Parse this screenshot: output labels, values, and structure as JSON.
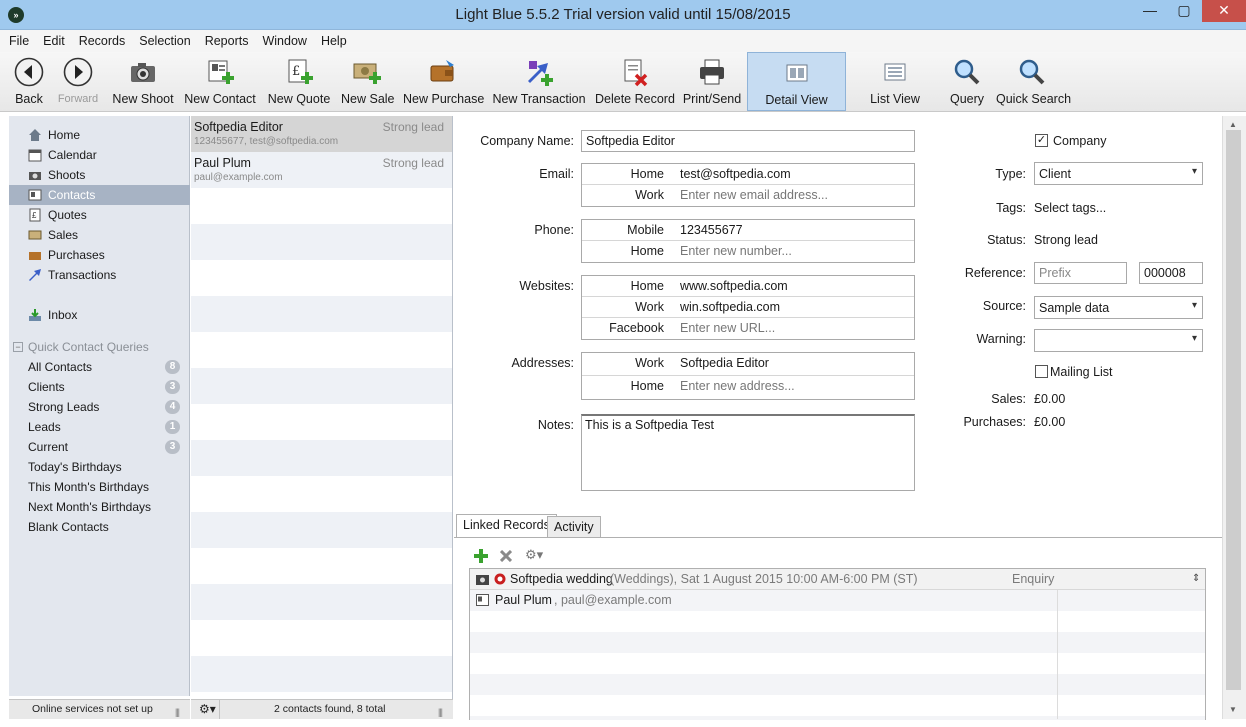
{
  "window": {
    "title": "Light Blue 5.5.2    Trial version valid until 15/08/2015",
    "controls": {
      "minimize": "—",
      "maximize": "▢",
      "close": "✕"
    }
  },
  "menu": [
    "File",
    "Edit",
    "Records",
    "Selection",
    "Reports",
    "Window",
    "Help"
  ],
  "toolbar": {
    "back": "Back",
    "forward": "Forward",
    "new_shoot": "New Shoot",
    "new_contact": "New Contact",
    "new_quote": "New Quote",
    "new_sale": "New Sale",
    "new_purchase": "New Purchase",
    "new_transaction": "New Transaction",
    "delete_record": "Delete Record",
    "print_send": "Print/Send",
    "detail_view": "Detail View",
    "list_view": "List View",
    "query": "Query",
    "quick_search": "Quick Search"
  },
  "sidebar": {
    "items": [
      {
        "label": "Home",
        "icon": "home-icon"
      },
      {
        "label": "Calendar",
        "icon": "calendar-icon"
      },
      {
        "label": "Shoots",
        "icon": "camera-icon"
      },
      {
        "label": "Contacts",
        "icon": "contact-card-icon"
      },
      {
        "label": "Quotes",
        "icon": "quote-icon"
      },
      {
        "label": "Sales",
        "icon": "sales-icon"
      },
      {
        "label": "Purchases",
        "icon": "purchase-icon"
      },
      {
        "label": "Transactions",
        "icon": "transaction-icon"
      }
    ],
    "inbox": "Inbox",
    "queries_header": "Quick Contact Queries",
    "queries_toggle": "−",
    "queries": [
      {
        "label": "All Contacts",
        "count": "8"
      },
      {
        "label": "Clients",
        "count": "3"
      },
      {
        "label": "Strong Leads",
        "count": "4"
      },
      {
        "label": "Leads",
        "count": "1"
      },
      {
        "label": "Current",
        "count": "3"
      },
      {
        "label": "Today's Birthdays",
        "count": ""
      },
      {
        "label": "This Month's Birthdays",
        "count": ""
      },
      {
        "label": "Next Month's Birthdays",
        "count": ""
      },
      {
        "label": "Blank Contacts",
        "count": ""
      }
    ],
    "status": "Online services not set up"
  },
  "contacts": {
    "rows": [
      {
        "name": "Softpedia Editor",
        "status": "Strong lead",
        "detail": "123455677, test@softpedia.com"
      },
      {
        "name": "Paul Plum",
        "status": "Strong lead",
        "detail": "paul@example.com"
      }
    ],
    "status": "2 contacts found, 8 total"
  },
  "detail": {
    "company_name_label": "Company Name:",
    "company_name": "Softpedia Editor",
    "email_label": "Email:",
    "emails": [
      {
        "type": "Home",
        "value": "test@softpedia.com"
      },
      {
        "type": "Work",
        "value": "Enter new email address..."
      }
    ],
    "phone_label": "Phone:",
    "phones": [
      {
        "type": "Mobile",
        "value": "123455677"
      },
      {
        "type": "Home",
        "value": "Enter new number..."
      }
    ],
    "websites_label": "Websites:",
    "websites": [
      {
        "type": "Home",
        "value": "www.softpedia.com"
      },
      {
        "type": "Work",
        "value": "win.softpedia.com"
      },
      {
        "type": "Facebook",
        "value": "Enter new URL..."
      }
    ],
    "addresses_label": "Addresses:",
    "addresses": [
      {
        "type": "Work",
        "value": "Softpedia Editor"
      },
      {
        "type": "Home",
        "value": "Enter new address..."
      }
    ],
    "notes_label": "Notes:",
    "notes": "This is a Softpedia Test",
    "company_checkbox": "Company",
    "type_label": "Type:",
    "type_value": "Client",
    "tags_label": "Tags:",
    "tags_value": "Select tags...",
    "status_label": "Status:",
    "status_value": "Strong lead",
    "reference_label": "Reference:",
    "reference_prefix": "Prefix",
    "reference_number": "000008",
    "source_label": "Source:",
    "source_value": "Sample data",
    "warning_label": "Warning:",
    "warning_value": "",
    "mailing_list": "Mailing List",
    "sales_label": "Sales:",
    "sales_value": "£0.00",
    "purchases_label": "Purchases:",
    "purchases_value": "£0.00"
  },
  "tabs": {
    "linked": "Linked Records",
    "activity": "Activity"
  },
  "linked_records": [
    {
      "title": "Softpedia wedding",
      "meta": " (Weddings), Sat 1 August 2015 10:00 AM-6:00 PM (ST)",
      "status": "Enquiry"
    },
    {
      "title": "Paul Plum",
      "meta": ", paul@example.com",
      "status": ""
    }
  ]
}
